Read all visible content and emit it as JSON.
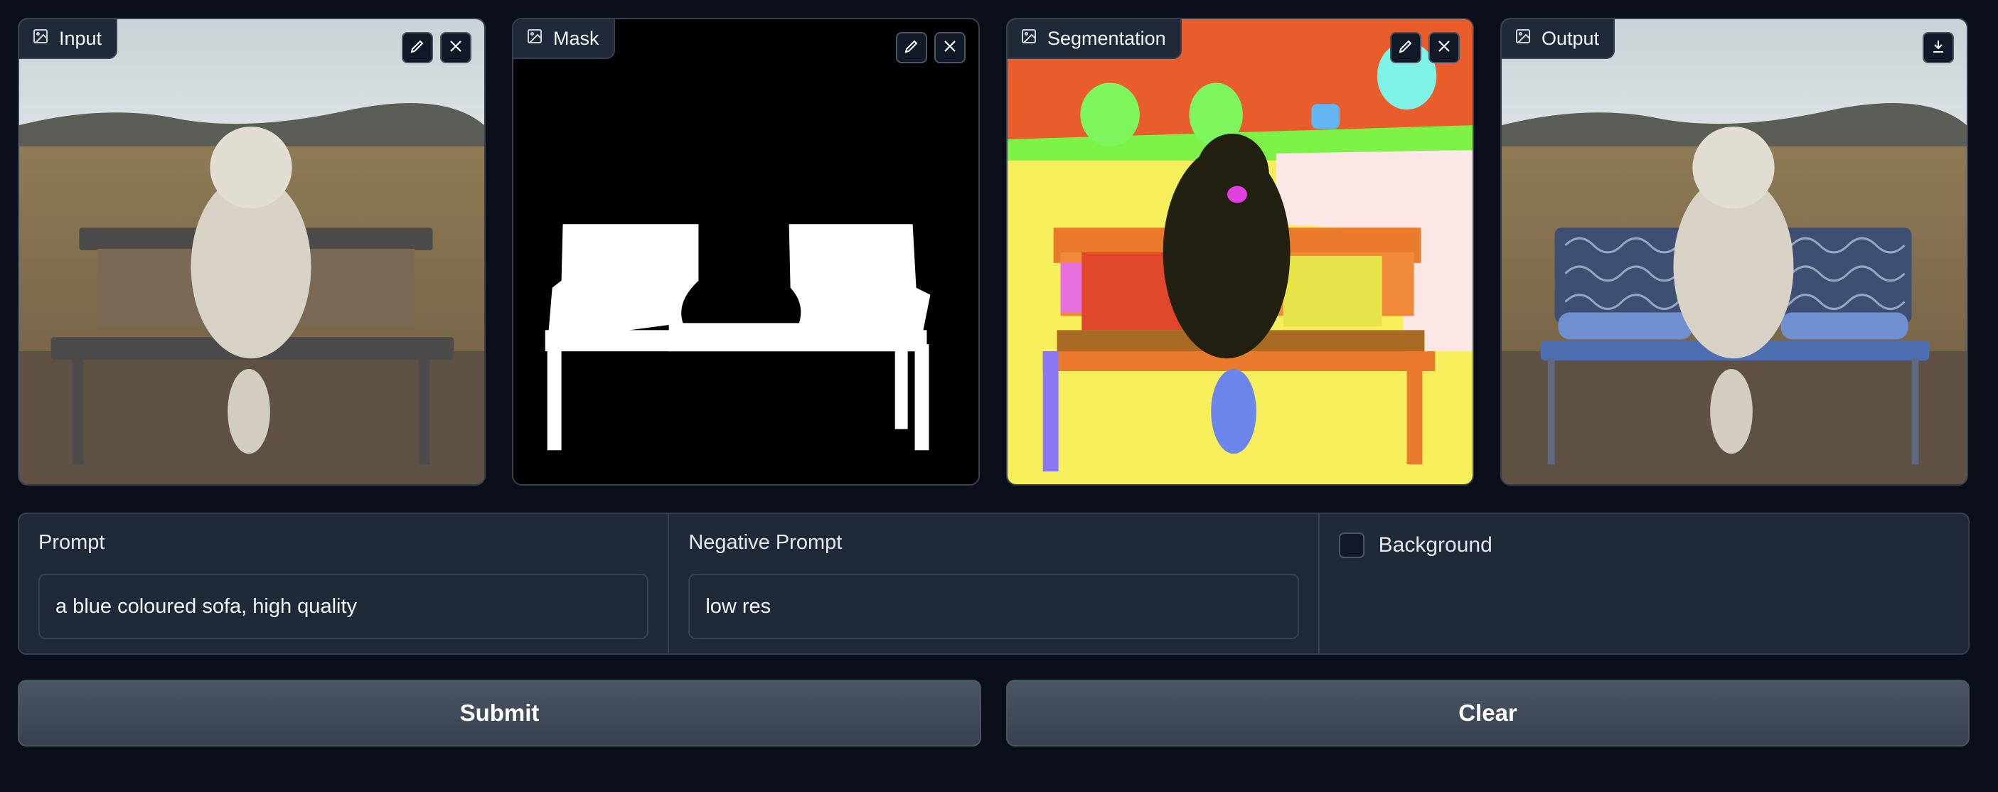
{
  "panels": {
    "input": {
      "label": "Input"
    },
    "mask": {
      "label": "Mask"
    },
    "segmentation": {
      "label": "Segmentation"
    },
    "output": {
      "label": "Output"
    }
  },
  "form": {
    "prompt": {
      "label": "Prompt",
      "value": "a blue coloured sofa, high quality"
    },
    "negative_prompt": {
      "label": "Negative Prompt",
      "value": "low res"
    },
    "background": {
      "label": "Background",
      "checked": false
    }
  },
  "actions": {
    "submit_label": "Submit",
    "clear_label": "Clear"
  },
  "icons": {
    "image": "image-icon",
    "edit": "pencil-icon",
    "clear": "close-icon",
    "download": "download-icon"
  },
  "colors": {
    "page_bg": "#0b0f19",
    "panel_bg": "#1f2937",
    "border": "#374151",
    "button_bg": "#4b5563"
  }
}
